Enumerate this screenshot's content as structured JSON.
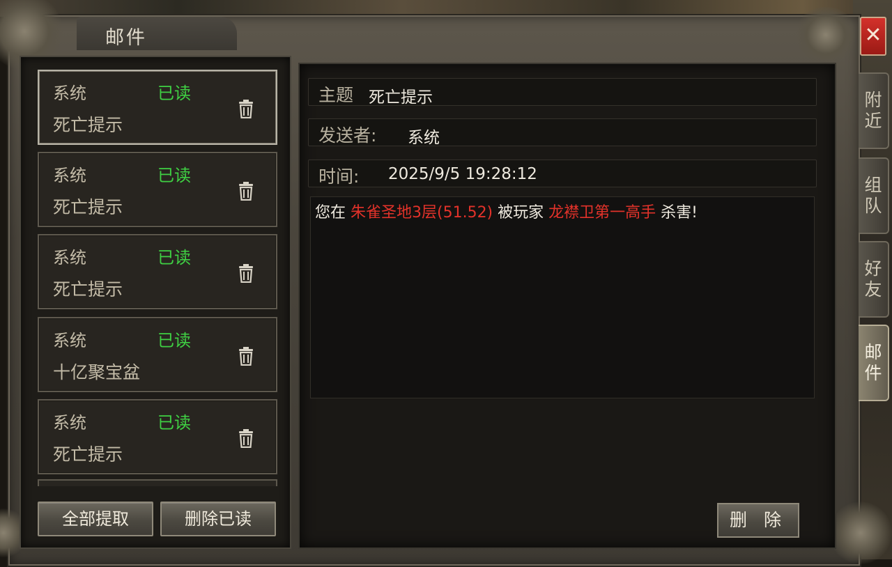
{
  "window": {
    "title": "邮件",
    "close_symbol": "✕"
  },
  "mail_list": [
    {
      "sender": "系统",
      "status": "已读",
      "subject": "死亡提示",
      "selected": true,
      "delete_icon": "trash-icon"
    },
    {
      "sender": "系统",
      "status": "已读",
      "subject": "死亡提示",
      "selected": false,
      "delete_icon": "trash-icon"
    },
    {
      "sender": "系统",
      "status": "已读",
      "subject": "死亡提示",
      "selected": false,
      "delete_icon": "trash-icon"
    },
    {
      "sender": "系统",
      "status": "已读",
      "subject": "十亿聚宝盆",
      "selected": false,
      "delete_icon": "trash-icon"
    },
    {
      "sender": "系统",
      "status": "已读",
      "subject": "死亡提示",
      "selected": false,
      "delete_icon": "trash-icon"
    }
  ],
  "list_buttons": {
    "collect_all": "全部提取",
    "delete_read": "删除已读"
  },
  "detail": {
    "subject_label": "主题",
    "subject_value": "死亡提示",
    "sender_label": "发送者:",
    "sender_value": "系统",
    "time_label": "时间:",
    "time_value": "2025/9/5 19:28:12",
    "message": {
      "part1": "您在 ",
      "location": "朱雀圣地3层(51.52)",
      "part2": " 被玩家 ",
      "killer": "龙襟卫第一高手",
      "part3": " 杀害!"
    },
    "delete_button": "删 除"
  },
  "side_tabs": [
    {
      "label_1": "附",
      "label_2": "近",
      "active": false
    },
    {
      "label_1": "组",
      "label_2": "队",
      "active": false
    },
    {
      "label_1": "好",
      "label_2": "友",
      "active": false
    },
    {
      "label_1": "邮",
      "label_2": "件",
      "active": true
    }
  ],
  "colors": {
    "status_read": "#3fd043",
    "highlight_red": "#e2322a",
    "close_red": "#c62a24"
  }
}
